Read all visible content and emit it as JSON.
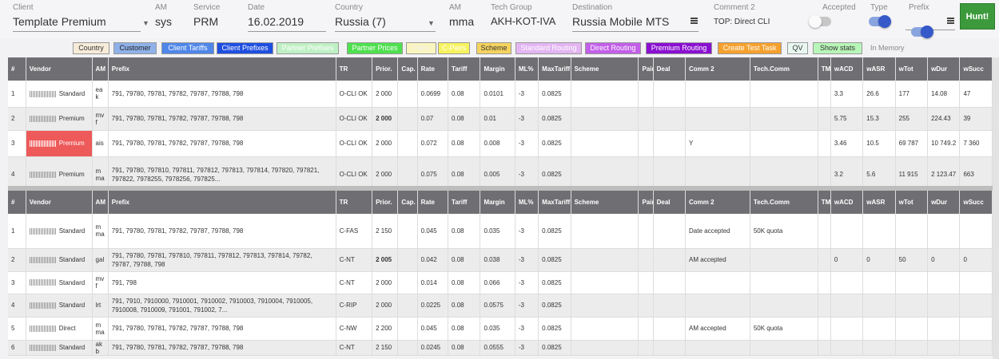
{
  "header": {
    "client_label": "Client",
    "client_value": "Template Premium",
    "am_label": "AM",
    "am_value": "sys",
    "service_label": "Service",
    "service_value": "PRM",
    "date_label": "Date",
    "date_value": "16.02.2019",
    "country_label": "Country",
    "country_value": "Russia (7)",
    "am2_label": "AM",
    "am2_value": "mma",
    "techgroup_label": "Tech Group",
    "techgroup_value": "AKH-KOT-IVA",
    "destination_label": "Destination",
    "destination_value": "Russia Mobile MTS",
    "comment2_label": "Comment 2",
    "comment2_value": "TOP: Direct CLI",
    "accepted_label": "Accepted",
    "type_label": "Type",
    "prefix_label": "Prefix",
    "hunt_label": "Hunt!"
  },
  "buttons": [
    {
      "label": "Country",
      "bg": "#f7ecd9",
      "color": "#333"
    },
    {
      "label": "Customer",
      "bg": "#8fb1e8",
      "color": "#222"
    },
    {
      "label": "Client Tariffs",
      "bg": "#4f86e8",
      "color": "#fff"
    },
    {
      "label": "Client Prefixes",
      "bg": "#1f4fe0",
      "color": "#fff"
    },
    {
      "label": "Partner Prefixes",
      "bg": "#bff0c5",
      "color": "#fff"
    },
    {
      "label": "Partner Prices",
      "bg": "#4fe04f",
      "color": "#fff"
    },
    {
      "label": "Pairs",
      "bg": "#fbf6c0",
      "color": "#eee"
    },
    {
      "label": "C-Pairs",
      "bg": "#f7f35f",
      "color": "#fff"
    },
    {
      "label": "Scheme",
      "bg": "#f5d35f",
      "color": "#333"
    },
    {
      "label": "Standard Routing",
      "bg": "#e3b5f2",
      "color": "#fff"
    },
    {
      "label": "Direct Routing",
      "bg": "#c25fe8",
      "color": "#fff"
    },
    {
      "label": "Premium Routing",
      "bg": "#8a10d0",
      "color": "#fff"
    },
    {
      "label": "Create Test Task",
      "bg": "#f6a12e",
      "color": "#fff"
    },
    {
      "label": "QV",
      "bg": "#e8f8f0",
      "color": "#333"
    },
    {
      "label": "Show stats",
      "bg": "#b8f5b8",
      "color": "#333"
    }
  ],
  "in_memory_label": "In Memory",
  "columns": [
    "#",
    "Vendor",
    "AM",
    "Prefix",
    "TR",
    "Prior.",
    "Cap.",
    "Rate",
    "Tariff",
    "Margin",
    "ML%",
    "MaxTariff",
    "Scheme",
    "Pair",
    "Deal",
    "Comm 2",
    "Tech.Comm",
    "TM",
    "wACD",
    "wASR",
    "wTot",
    "wDur",
    "wSucc"
  ],
  "table1": [
    {
      "n": "1",
      "vendor": "Standard",
      "am": "eak",
      "prefix": "791, 79780, 79781, 79782, 79787, 79788, 798",
      "tr": "O-CLI OK",
      "prior": "2 000",
      "rate": "0.0699",
      "tariff": "0.08",
      "margin": "0.0101",
      "ml": "-3",
      "max": "0.0825",
      "comm2": "",
      "tech": "",
      "wacd": "3.3",
      "wasr": "26.6",
      "wtot": "177",
      "wdur": "14.08",
      "wsucc": "47"
    },
    {
      "n": "2",
      "vendor": "Premium",
      "am": "mvf",
      "prefix": "791, 79780, 79781, 79782, 79787, 79788, 798",
      "tr": "O-CLI OK",
      "prior": "2 000",
      "rate": "0.07",
      "tariff": "0.08",
      "margin": "0.01",
      "ml": "-3",
      "max": "0.0825",
      "comm2": "",
      "tech": "",
      "wacd": "5.75",
      "wasr": "15.3",
      "wtot": "255",
      "wdur": "224.43",
      "wsucc": "39"
    },
    {
      "n": "3",
      "vendor": "Premium",
      "am": "ais",
      "prefix": "791, 79780, 79781, 79782, 79787, 79788, 798",
      "tr": "O-CLI OK",
      "prior": "2 000",
      "rate": "0.072",
      "tariff": "0.08",
      "margin": "0.008",
      "ml": "-3",
      "max": "0.0825",
      "comm2": "Y",
      "tech": "",
      "wacd": "3.46",
      "wasr": "10.5",
      "wtot": "69 787",
      "wdur": "10 749.2",
      "wsucc": "7 360"
    },
    {
      "n": "4",
      "vendor": "Premium",
      "am": "mma",
      "prefix": "791, 79780, 797810, 797811, 797812, 797813, 797814, 797820, 797821, 797822, 7978255, 7978256, 797825...",
      "tr": "O-CLI OK",
      "prior": "2 000",
      "rate": "0.075",
      "tariff": "0.08",
      "margin": "0.005",
      "ml": "-3",
      "max": "0.0825",
      "comm2": "",
      "tech": "",
      "wacd": "3.2",
      "wasr": "5.6",
      "wtot": "11 915",
      "wdur": "2 123.47",
      "wsucc": "663"
    }
  ],
  "table2": [
    {
      "n": "1",
      "vendor": "Standard",
      "am": "mma",
      "prefix": "791, 79780, 79781, 79782, 79787, 79788, 798",
      "tr": "C-FAS",
      "prior": "2 150",
      "rate": "0.045",
      "tariff": "0.08",
      "margin": "0.035",
      "ml": "-3",
      "max": "0.0825",
      "comm2": "Date accepted",
      "tech": "50K quota",
      "wacd": "",
      "wasr": "",
      "wtot": "",
      "wdur": "",
      "wsucc": ""
    },
    {
      "n": "2",
      "vendor": "Standard",
      "am": "gal",
      "prefix": "791, 79780, 79781, 797810, 797811, 797812, 797813, 797814, 79782, 79787, 79788, 798",
      "tr": "C-NT",
      "prior": "2 005",
      "rate": "0.042",
      "tariff": "0.08",
      "margin": "0.038",
      "ml": "-3",
      "max": "0.0825",
      "comm2": "AM accepted",
      "tech": "",
      "wacd": "0",
      "wasr": "0",
      "wtot": "50",
      "wdur": "0",
      "wsucc": "0"
    },
    {
      "n": "3",
      "vendor": "Standard",
      "am": "mvf",
      "prefix": "791, 798",
      "tr": "C-NT",
      "prior": "2 000",
      "rate": "0.014",
      "tariff": "0.08",
      "margin": "0.066",
      "ml": "-3",
      "max": "0.0825",
      "comm2": "",
      "tech": "",
      "wacd": "",
      "wasr": "",
      "wtot": "",
      "wdur": "",
      "wsucc": ""
    },
    {
      "n": "4",
      "vendor": "Standard",
      "am": "lrt",
      "prefix": "791, 7910, 7910000, 7910001, 7910002, 7910003, 7910004, 7910005, 7910008, 7910009, 791001, 791002, 7...",
      "tr": "C-RIP",
      "prior": "2 000",
      "rate": "0.0225",
      "tariff": "0.08",
      "margin": "0.0575",
      "ml": "-3",
      "max": "0.0825",
      "comm2": "",
      "tech": "",
      "wacd": "",
      "wasr": "",
      "wtot": "",
      "wdur": "",
      "wsucc": ""
    },
    {
      "n": "5",
      "vendor": "Direct",
      "am": "mma",
      "prefix": "791, 79780, 79781, 79782, 79787, 79788, 798",
      "tr": "C-NW",
      "prior": "2 200",
      "rate": "0.045",
      "tariff": "0.08",
      "margin": "0.035",
      "ml": "-3",
      "max": "0.0825",
      "comm2": "AM accepted",
      "tech": "50K quota",
      "wacd": "",
      "wasr": "",
      "wtot": "",
      "wdur": "",
      "wsucc": ""
    },
    {
      "n": "6",
      "vendor": "Standard",
      "am": "akb",
      "prefix": "791, 79780, 79781, 79782, 79787, 79788, 798",
      "tr": "C-NT",
      "prior": "2 150",
      "rate": "0.0245",
      "tariff": "0.08",
      "margin": "0.0555",
      "ml": "-3",
      "max": "0.0825",
      "comm2": "",
      "tech": "",
      "wacd": "",
      "wasr": "",
      "wtot": "",
      "wdur": "",
      "wsucc": ""
    }
  ]
}
